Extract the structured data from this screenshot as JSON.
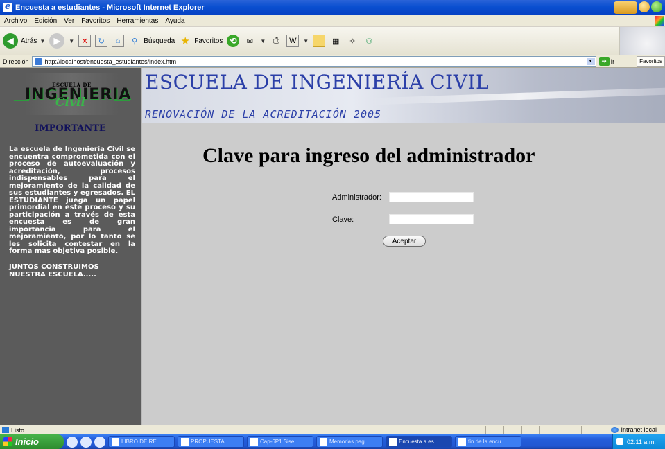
{
  "window": {
    "title": "Encuesta a estudiantes - Microsoft Internet Explorer"
  },
  "menu": [
    "Archivo",
    "Edición",
    "Ver",
    "Favoritos",
    "Herramientas",
    "Ayuda"
  ],
  "toolbar": {
    "back_label": "Atrás",
    "search_label": "Búsqueda",
    "favorites_label": "Favoritos"
  },
  "address": {
    "label": "Dirección",
    "url": "http://localhost/encuesta_estudiantes/index.htm",
    "go_label": "Ir",
    "favorites_button": "Favoritos"
  },
  "sidebar": {
    "logo_top": "ESCUELA DE",
    "logo_main": "INGENIERIA",
    "logo_civil": "Civil",
    "important_title": "IMPORTANTE",
    "important_text": "La escuela de Ingeniería Civil se encuentra comprometida con el proceso de autoevaluación y acreditación, procesos indispensables para el mejoramiento de la calidad de sus estudiantes y egresados. EL ESTUDIANTE juega un papel primordial en este proceso y su participación a través de esta encuesta es de gran importancia para el mejoramiento, por lo tanto se les solicita contestar en la forma mas objetiva posible.",
    "slogan": "JUNTOS CONSTRUIMOS NUESTRA ESCUELA....."
  },
  "banner": {
    "title": "ESCUELA DE INGENIERÍA CIVIL",
    "subtitle": "RENOVACIÓN DE LA ACREDITACIÓN 2005"
  },
  "form": {
    "title": "Clave para ingreso del administrador",
    "admin_label": "Administrador:",
    "admin_value": "",
    "clave_label": "Clave:",
    "clave_value": "",
    "submit_label": "Aceptar"
  },
  "status": {
    "text": "Listo",
    "zone": "Intranet local"
  },
  "taskbar": {
    "start_label": "Inicio",
    "tasks": [
      "LIBRO DE RE...",
      "PROPUESTA ...",
      "Cap-6P1 Sise...",
      "Memorias pagi...",
      "Encuesta a es...",
      "fin de la encu..."
    ],
    "active_task_index": 4,
    "clock": "02:11 a.m."
  }
}
